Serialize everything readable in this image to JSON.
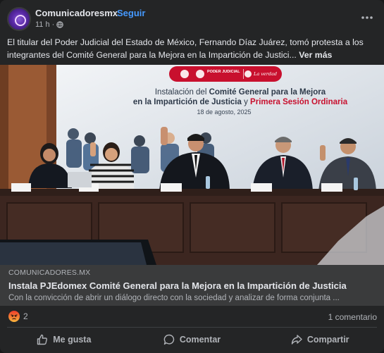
{
  "header": {
    "page_name": "Comunicadoresmx",
    "dot": "·",
    "follow": "Seguir",
    "time": "11 h",
    "time_dot": "·",
    "privacy_icon": "globe-icon"
  },
  "post": {
    "text": "El titular del Poder Judicial del Estado de México, Fernando Díaz Juárez, tomó protesta a los integrantes del Comité General para la Mejora en la Impartición de Justici...",
    "see_more": "Ver más"
  },
  "photo": {
    "banner_logo_text": "PODER JUDICIAL",
    "banner_slogan": "La verdad",
    "heading_line1_pre": "Instalación del ",
    "heading_line1_bold": "Comité General para la Mejora",
    "heading_line2_bold": "en la Impartición de Justicia",
    "heading_line2_mid": " y ",
    "heading_line2_red": "Primera Sesión Ordinaria",
    "date": "18 de agosto, 2025",
    "accent_red": "#c8102e"
  },
  "link": {
    "domain": "COMUNICADORES.MX",
    "title": "Instala PJEdomex Comité General para la Mejora en la Impartición de Justicia",
    "description": "Con la convicción de abrir un diálogo directo con la sociedad y analizar de forma conjunta ..."
  },
  "reactions": {
    "count": "2",
    "comments": "1 comentario"
  },
  "actions": {
    "like": "Me gusta",
    "comment": "Comentar",
    "share": "Compartir"
  },
  "colors": {
    "card_bg": "#242526",
    "link_bg": "#3a3b3c",
    "follow_blue": "#4599ff"
  }
}
